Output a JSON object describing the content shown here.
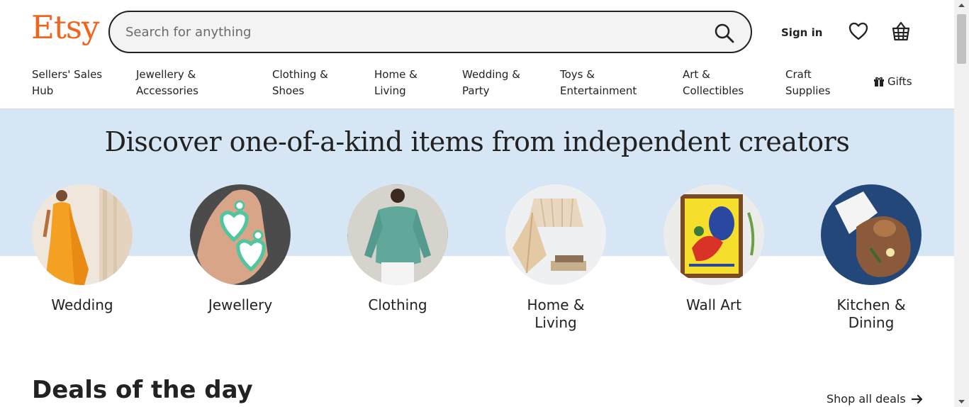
{
  "header": {
    "logo": "Etsy",
    "search_placeholder": "Search for anything",
    "sign_in": "Sign in"
  },
  "nav": {
    "items": [
      {
        "line1": "Sellers' Sales",
        "line2": "Hub"
      },
      {
        "line1": "Jewellery &",
        "line2": "Accessories"
      },
      {
        "line1": "Clothing &",
        "line2": "Shoes"
      },
      {
        "line1": "Home &",
        "line2": "Living"
      },
      {
        "line1": "Wedding &",
        "line2": "Party"
      },
      {
        "line1": "Toys &",
        "line2": "Entertainment"
      },
      {
        "line1": "Art &",
        "line2": "Collectibles"
      },
      {
        "line1": "Craft",
        "line2": "Supplies"
      }
    ],
    "gifts": "Gifts"
  },
  "hero": {
    "title": "Discover one-of-a-kind items from independent creators",
    "categories": [
      {
        "label": "Wedding",
        "label2": ""
      },
      {
        "label": "Jewellery",
        "label2": ""
      },
      {
        "label": "Clothing",
        "label2": ""
      },
      {
        "label": "Home & Living",
        "label2": ""
      },
      {
        "label": "Wall Art",
        "label2": ""
      },
      {
        "label": "Kitchen &",
        "label2": "Dining"
      }
    ]
  },
  "deals": {
    "title": "Deals of the day",
    "shop_all": "Shop all deals"
  },
  "colors": {
    "brand": "#f1641e",
    "hero_band": "#d7e6f5",
    "text": "#222222"
  },
  "icons": [
    "search-icon",
    "heart-icon",
    "basket-icon",
    "gift-icon",
    "arrow-right-icon"
  ]
}
